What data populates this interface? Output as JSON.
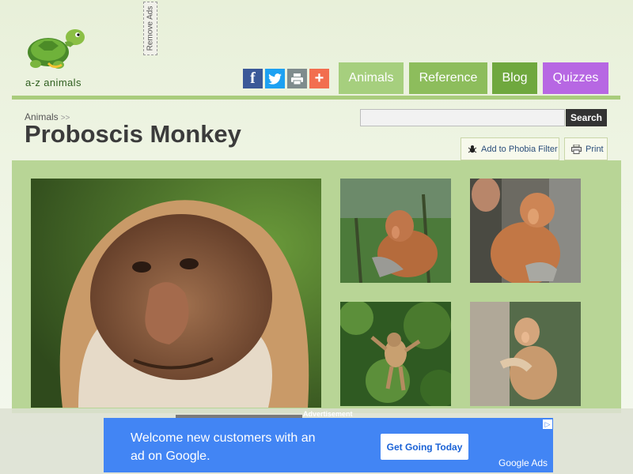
{
  "brand": {
    "logo_text": "a-z animals",
    "remove_ads": "Remove Ads"
  },
  "share": [
    {
      "icon": "facebook-icon",
      "glyph": "f",
      "color": "#3b5998"
    },
    {
      "icon": "twitter-icon",
      "glyph": "",
      "color": "#1da1f2"
    },
    {
      "icon": "print-icon",
      "glyph": "",
      "color": "#7f8c8d"
    },
    {
      "icon": "plus-icon",
      "glyph": "+",
      "color": "#f26e4f"
    }
  ],
  "nav": {
    "animals": "Animals",
    "reference": "Reference",
    "blog": "Blog",
    "quizzes": "Quizzes"
  },
  "nav_colors": {
    "animals": "#a6cf7e",
    "reference": "#8dbd5c",
    "blog": "#6fa83e",
    "quizzes": "#b767e3"
  },
  "breadcrumb": {
    "item": "Animals",
    "separator": ">>"
  },
  "page": {
    "title": "Proboscis Monkey"
  },
  "search": {
    "placeholder": "",
    "button": "Search"
  },
  "actions": {
    "phobia": "Add to Phobia Filter",
    "print": "Print"
  },
  "ad": {
    "label": "Advertisement",
    "headline": "Welcome new customers with an ad on Google.",
    "cta": "Get Going Today",
    "brand": "Google Ads"
  }
}
